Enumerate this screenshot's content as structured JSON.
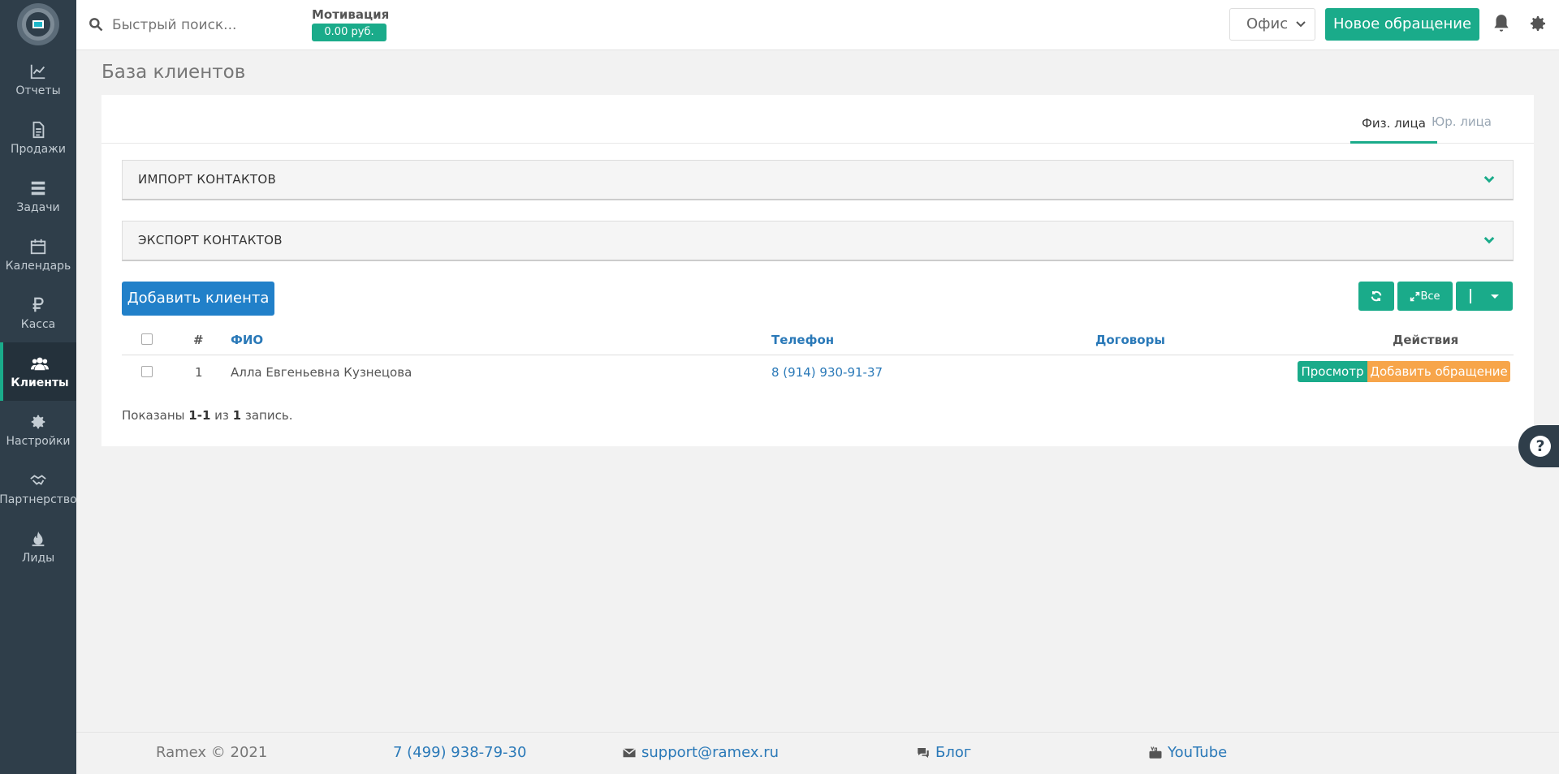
{
  "sidebar": {
    "items": [
      {
        "label": "Отчеты",
        "icon": "line-chart-icon"
      },
      {
        "label": "Продажи",
        "icon": "document-icon"
      },
      {
        "label": "Задачи",
        "icon": "tasks-icon"
      },
      {
        "label": "Календарь",
        "icon": "calendar-icon"
      },
      {
        "label": "Касса",
        "icon": "ruble-icon"
      },
      {
        "label": "Клиенты",
        "icon": "users-icon"
      },
      {
        "label": "Настройки",
        "icon": "gear-icon"
      },
      {
        "label": "Партнерство",
        "icon": "handshake-icon"
      },
      {
        "label": "Лиды",
        "icon": "fire-icon"
      }
    ],
    "active": "Клиенты"
  },
  "topbar": {
    "search_placeholder": "Быстрый поиск...",
    "motivation_label": "Мотивация",
    "motivation_value": "0.00 руб.",
    "office_select": "Офис",
    "new_request_label": "Новое обращение"
  },
  "page": {
    "title": "База клиентов",
    "tabs": [
      {
        "label": "Физ. лица"
      },
      {
        "label": "Юр. лица"
      }
    ],
    "import_label": "ИМПОРТ КОНТАКТОВ",
    "export_label": "ЭКСПОРТ КОНТАКТОВ",
    "add_client_label": "Добавить клиента",
    "toolbar": {
      "all_label": "Все"
    },
    "table": {
      "headers": {
        "num": "#",
        "name": "ФИО",
        "phone": "Телефон",
        "contracts": "Договоры",
        "actions": "Действия"
      },
      "rows": [
        {
          "num": "1",
          "name": "Алла Евгеньевна Кузнецова",
          "phone": "8 (914) 930-91-37",
          "contracts": "",
          "view": "Просмотр",
          "add_request": "Добавить обращение"
        }
      ]
    },
    "summary": {
      "prefix": "Показаны ",
      "range": "1-1",
      "mid": " из ",
      "total": "1",
      "suffix": " запись."
    }
  },
  "footer": {
    "copyright": "Ramex © 2021",
    "phone": "7 (499) 938-79-30",
    "email": "support@ramex.ru",
    "blog": "Блог",
    "youtube": "YouTube"
  },
  "colors": {
    "sidebar_bg": "#2f3e4a",
    "accent_green": "#1aab8a",
    "primary_blue": "#2180c9",
    "link_blue": "#2a79b8",
    "orange": "#f7a54a"
  }
}
